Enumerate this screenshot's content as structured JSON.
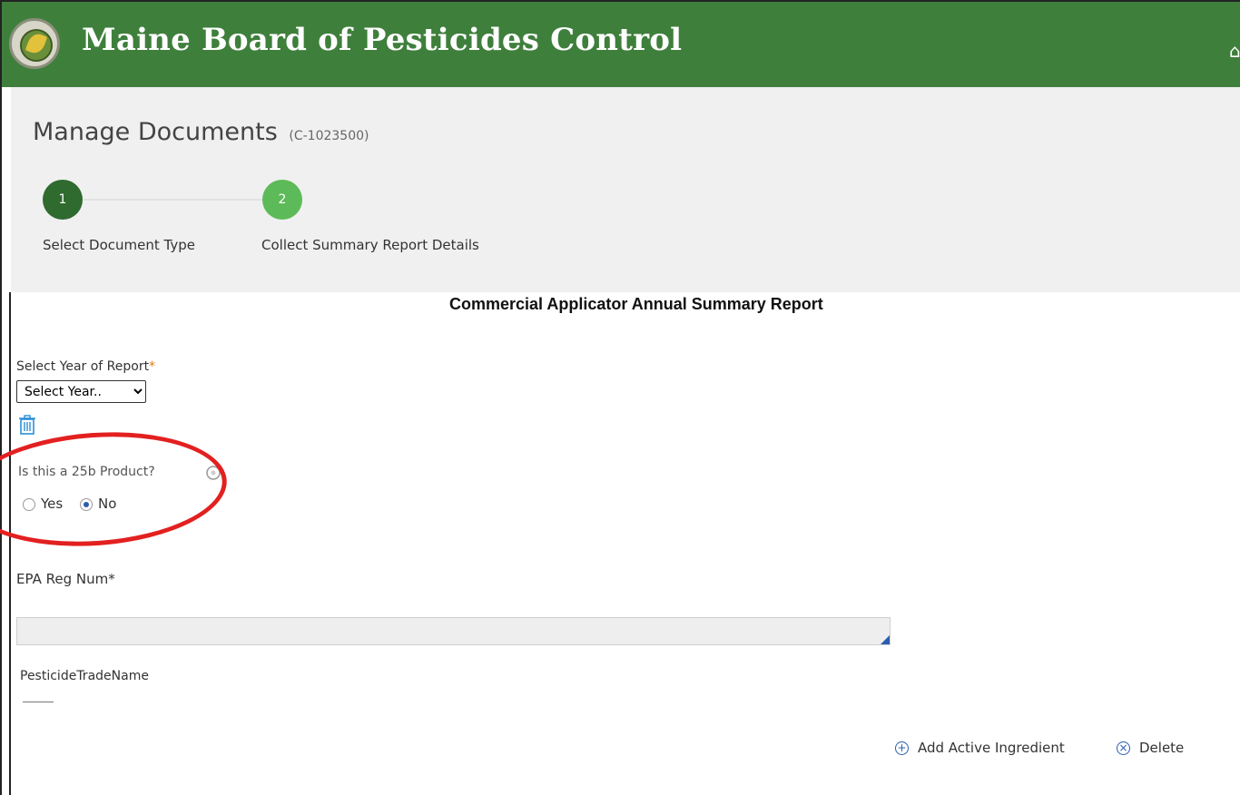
{
  "header": {
    "title": "Maine Board of Pesticides Control",
    "home_icon": "home-icon"
  },
  "page": {
    "title": "Manage Documents",
    "case_id": "(C-1023500)"
  },
  "steps": [
    {
      "number": "1",
      "label": "Select Document Type"
    },
    {
      "number": "2",
      "label": "Collect Summary Report Details"
    }
  ],
  "form": {
    "report_title": "Commercial Applicator Annual Summary Report",
    "year_label": "Select Year of Report",
    "year_required": "*",
    "year_select_value": "Select Year..",
    "product_question": "Is this a 25b Product?",
    "yes_label": "Yes",
    "no_label": "No",
    "selected_option": "No",
    "epa_label": "EPA Reg Num*",
    "epa_value": "",
    "trade_name_label": "PesticideTradeName",
    "add_ingredient_label": "Add Active Ingredient",
    "delete_label": "Delete"
  },
  "colors": {
    "header_green": "#3f7f3c",
    "step_done": "#2f6a2e",
    "step_active": "#5cbb58",
    "annotation_red": "#e32020",
    "link_blue": "#2a5db0"
  }
}
